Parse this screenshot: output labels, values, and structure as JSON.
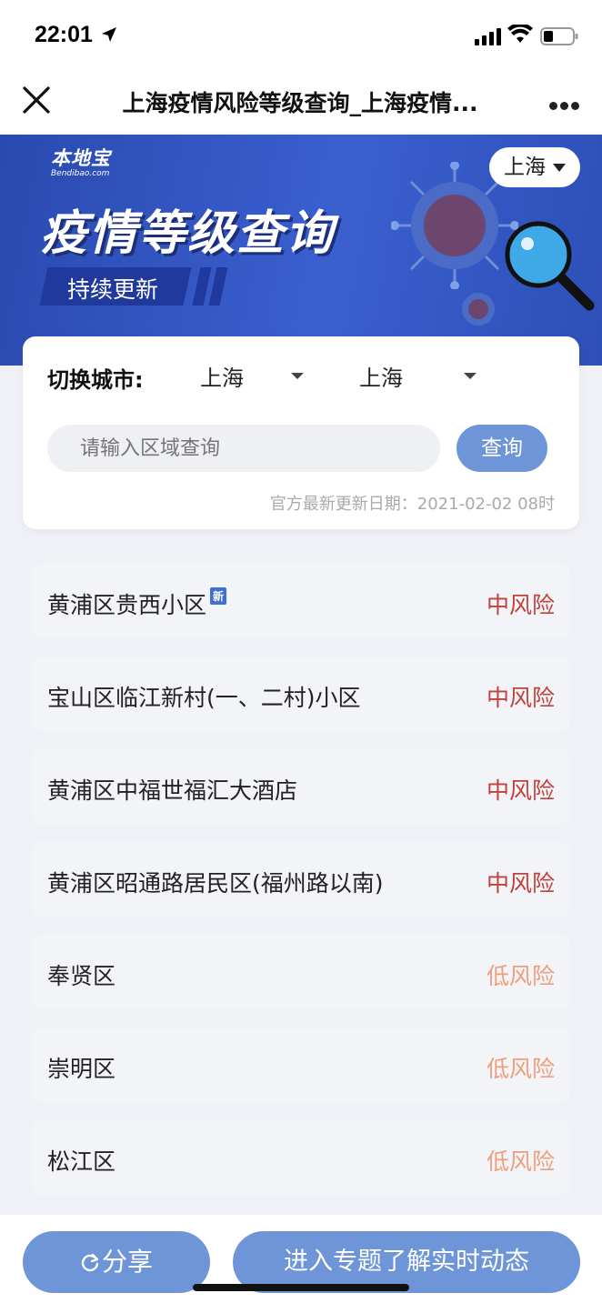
{
  "status_bar": {
    "time": "22:01"
  },
  "nav": {
    "title": "上海疫情风险等级查询_上海疫情..."
  },
  "banner": {
    "logo_cn": "本地宝",
    "logo_en": "Bendibao.com",
    "title": "疫情等级查询",
    "subtitle": "持续更新",
    "city": "上海"
  },
  "search_card": {
    "switch_label": "切换城市:",
    "province": "上海",
    "city": "上海",
    "placeholder": "请输入区域查询",
    "search_button": "查询",
    "update_date": "官方最新更新日期：2021-02-02 08时"
  },
  "list": [
    {
      "name": "黄浦区贵西小区",
      "badge": "新",
      "risk": "中风险",
      "level": "mid"
    },
    {
      "name": "宝山区临江新村(一、二村)小区",
      "badge": "",
      "risk": "中风险",
      "level": "mid"
    },
    {
      "name": "黄浦区中福世福汇大酒店",
      "badge": "",
      "risk": "中风险",
      "level": "mid"
    },
    {
      "name": "黄浦区昭通路居民区(福州路以南)",
      "badge": "",
      "risk": "中风险",
      "level": "mid"
    },
    {
      "name": "奉贤区",
      "badge": "",
      "risk": "低风险",
      "level": "low"
    },
    {
      "name": "崇明区",
      "badge": "",
      "risk": "低风险",
      "level": "low"
    },
    {
      "name": "松江区",
      "badge": "",
      "risk": "低风险",
      "level": "low"
    }
  ],
  "bottom": {
    "share_label": "分享",
    "topic_label": "进入专题了解实时动态"
  },
  "colors": {
    "accent": "#6e95d8",
    "banner": "#2a4ab0",
    "risk_mid": "#c4403a",
    "risk_low": "#ee9e7c"
  },
  "icons": [
    "location-arrow-icon",
    "signal-icon",
    "wifi-icon",
    "battery-icon",
    "close-icon",
    "more-icon",
    "virus-icon",
    "magnifier-icon",
    "dropdown-icon",
    "share-icon"
  ]
}
